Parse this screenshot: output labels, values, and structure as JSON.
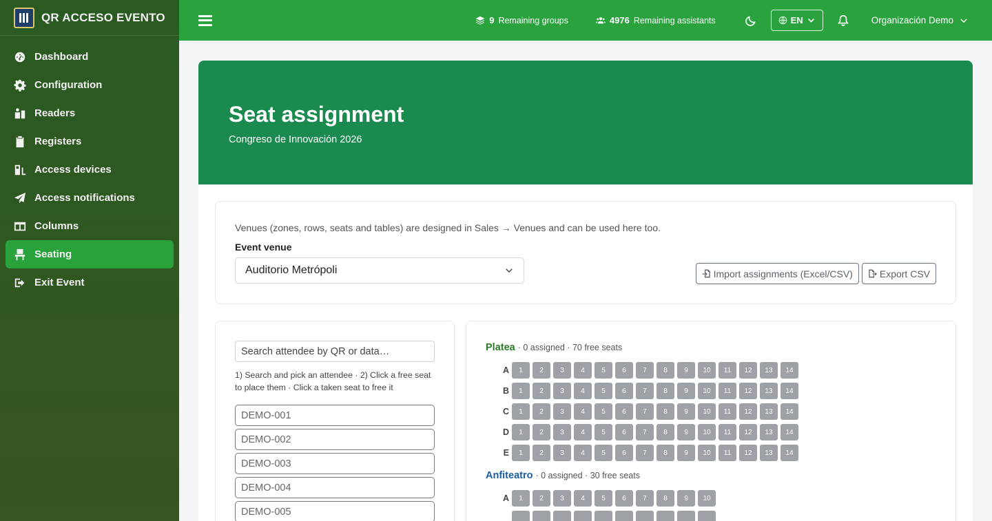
{
  "brand": {
    "title": "QR ACCESO EVENTO"
  },
  "sidebar": {
    "items": [
      {
        "label": "Dashboard",
        "icon": "dashboard-icon"
      },
      {
        "label": "Configuration",
        "icon": "gear-icon"
      },
      {
        "label": "Readers",
        "icon": "reader-icon"
      },
      {
        "label": "Registers",
        "icon": "clipboard-icon"
      },
      {
        "label": "Access devices",
        "icon": "device-icon"
      },
      {
        "label": "Access notifications",
        "icon": "paper-plane-icon"
      },
      {
        "label": "Columns",
        "icon": "columns-icon"
      },
      {
        "label": "Seating",
        "icon": "seat-icon",
        "active": true
      },
      {
        "label": "Exit Event",
        "icon": "exit-icon"
      }
    ]
  },
  "topbar": {
    "groups_count": "9",
    "groups_label": "Remaining groups",
    "assistants_count": "4976",
    "assistants_label": "Remaining assistants",
    "lang": "EN",
    "org": "Organización Demo"
  },
  "hero": {
    "title": "Seat assignment",
    "subtitle": "Congreso de Innovación 2026"
  },
  "venue": {
    "info": "Venues (zones, rows, seats and tables) are designed in Sales → Venues and can be used here too.",
    "label": "Event venue",
    "selected": "Auditorio Metrópoli",
    "import_label": "Import assignments (Excel/CSV)",
    "export_label": "Export CSV"
  },
  "attendees": {
    "search_placeholder": "Search attendee by QR or data…",
    "hint": "1) Search and pick an attendee · 2) Click a free seat to place them · Click a taken seat to free it",
    "items": [
      "DEMO-001",
      "DEMO-002",
      "DEMO-003",
      "DEMO-004",
      "DEMO-005"
    ]
  },
  "zones": [
    {
      "name": "Platea",
      "color": "#2a7a2a",
      "summary": "· 0 assigned · 70 free seats",
      "rows": [
        {
          "label": "A",
          "seats": [
            "1",
            "2",
            "3",
            "4",
            "5",
            "6",
            "7",
            "8",
            "9",
            "10",
            "11",
            "12",
            "13",
            "14"
          ]
        },
        {
          "label": "B",
          "seats": [
            "1",
            "2",
            "3",
            "4",
            "5",
            "6",
            "7",
            "8",
            "9",
            "10",
            "11",
            "12",
            "13",
            "14"
          ]
        },
        {
          "label": "C",
          "seats": [
            "1",
            "2",
            "3",
            "4",
            "5",
            "6",
            "7",
            "8",
            "9",
            "10",
            "11",
            "12",
            "13",
            "14"
          ]
        },
        {
          "label": "D",
          "seats": [
            "1",
            "2",
            "3",
            "4",
            "5",
            "6",
            "7",
            "8",
            "9",
            "10",
            "11",
            "12",
            "13",
            "14"
          ]
        },
        {
          "label": "E",
          "seats": [
            "1",
            "2",
            "3",
            "4",
            "5",
            "6",
            "7",
            "8",
            "9",
            "10",
            "11",
            "12",
            "13",
            "14"
          ]
        }
      ]
    },
    {
      "name": "Anfiteatro",
      "color": "#1a5fa0",
      "summary": "· 0 assigned · 30 free seats",
      "rows": [
        {
          "label": "A",
          "seats": [
            "1",
            "2",
            "3",
            "4",
            "5",
            "6",
            "7",
            "8",
            "9",
            "10"
          ]
        },
        {
          "label": "",
          "seats": [
            "",
            "",
            "",
            "",
            "",
            "",
            "",
            "",
            "",
            ""
          ]
        }
      ]
    }
  ]
}
